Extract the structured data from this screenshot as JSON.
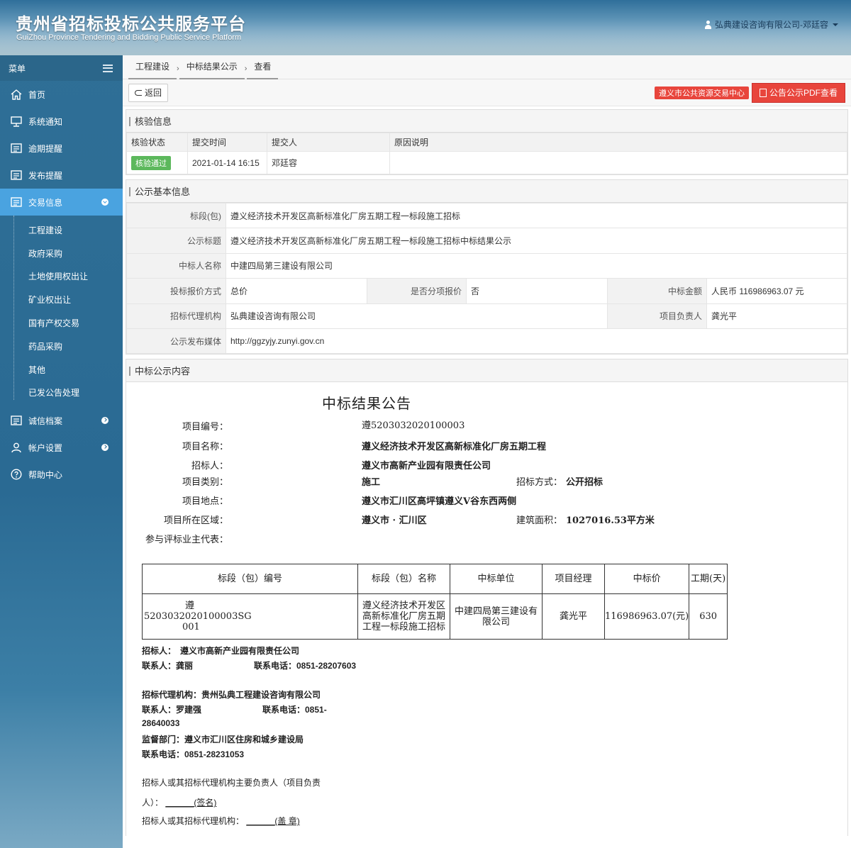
{
  "header": {
    "title": "贵州省招标投标公共服务平台",
    "subtitle": "GuiZhou Province Tendering and Bidding Public Service Platform",
    "user": "弘典建设咨询有限公司-邓廷容"
  },
  "sidebar": {
    "menu_label": "菜单",
    "items": [
      {
        "label": "首页",
        "icon": "home-icon"
      },
      {
        "label": "系统通知",
        "icon": "monitor-icon"
      },
      {
        "label": "逾期提醒",
        "icon": "list-icon"
      },
      {
        "label": "发布提醒",
        "icon": "list-icon"
      },
      {
        "label": "交易信息",
        "icon": "list-icon"
      },
      {
        "label": "诚信档案",
        "icon": "list-icon"
      },
      {
        "label": "帐户设置",
        "icon": "user-icon"
      },
      {
        "label": "帮助中心",
        "icon": "question-icon"
      }
    ],
    "subitems": [
      "工程建设",
      "政府采购",
      "土地使用权出让",
      "矿业权出让",
      "国有产权交易",
      "药品采购",
      "其他",
      "已发公告处理"
    ]
  },
  "breadcrumb": [
    "工程建设",
    "中标结果公示",
    "查看"
  ],
  "toolbar": {
    "back_label": "返回",
    "center_tag": "遵义市公共资源交易中心",
    "pdf_label": "公告公示PDF查看"
  },
  "verify": {
    "title": "核验信息",
    "headers": [
      "核验状态",
      "提交时间",
      "提交人",
      "原因说明"
    ],
    "status": "核验通过",
    "time": "2021-01-14 16:15",
    "submitter": "邓廷容",
    "reason": ""
  },
  "basic": {
    "title": "公示基本信息",
    "section_label": "标段(包)",
    "section_value": "遵义经济技术开发区高新标准化厂房五期工程一标段施工招标",
    "notice_title_label": "公示标题",
    "notice_title_value": "遵义经济技术开发区高新标准化厂房五期工程一标段施工招标中标结果公示",
    "winner_label": "中标人名称",
    "winner_value": "中建四局第三建设有限公司",
    "quote_method_label": "投标报价方式",
    "quote_method_value": "总价",
    "itemized_label": "是否分项报价",
    "itemized_value": "否",
    "amount_label": "中标金额",
    "amount_value": "人民币 116986963.07 元",
    "agency_label": "招标代理机构",
    "agency_value": "弘典建设咨询有限公司",
    "manager_label": "项目负责人",
    "manager_value": "龚光平",
    "media_label": "公示发布媒体",
    "media_value": "http://ggzyjy.zunyi.gov.cn"
  },
  "content": {
    "title": "中标公示内容",
    "doc_title": "中标结果公告",
    "project_no_label": "项目编号：",
    "project_no_value": "遵5203032020100003",
    "project_name_label": "项目名称：",
    "project_name_value": "遵义经济技术开发区高新标准化厂房五期工程",
    "tenderer_label": "招标人：",
    "tenderer_value": "遵义市高新产业园有限责任公司",
    "category_label": "项目类别：",
    "category_value": "施工",
    "method_label": "招标方式：",
    "method_value": "公开招标",
    "location_label": "项目地点：",
    "location_value": "遵义市汇川区高坪镇遵义V谷东西两侧",
    "region_label": "项目所在区域：",
    "region_value": "遵义市 · 汇川区",
    "area_label": "建筑面积：",
    "area_value": "1027016.53平方米",
    "rep_label": "参与评标业主代表：",
    "table_headers": [
      "标段（包）编号",
      "标段（包）名称",
      "中标单位",
      "项目经理",
      "中标价",
      "工期(天)"
    ],
    "table_row": {
      "code_line1": "遵",
      "code_line2": "5203032020100003SG",
      "code_line3": "001",
      "name": "遵义经济技术开发区高新标准化厂房五期工程一标段施工招标",
      "unit": "中建四局第三建设有限公司",
      "manager": "龚光平",
      "price": "116986963.07(元)",
      "duration": "630"
    },
    "tenderer_line": "招标人：　遵义市高新产业园有限责任公司",
    "contact1": "联系人：龚丽",
    "phone1": "联系电话：0851-28207603",
    "agency_line": "招标代理机构：贵州弘典工程建设咨询有限公司",
    "contact2": "联系人：罗建强",
    "phone2a": "联系电话：0851-",
    "phone2b": "28640033",
    "supervisor_line": "监督部门：遵义市汇川区住房和城乡建设局",
    "phone3": "联系电话：0851-28231053",
    "sig1a": "招标人或其招标代理机构主要负责人（项目负责",
    "sig1b": "人）：",
    "sig1c": "______(签名)",
    "sig2a": "招标人或其招标代理机构：",
    "sig2b": "______(盖 章)"
  },
  "colors": {
    "accent": "#4aa3e0",
    "danger": "#e8453c",
    "success": "#5cb85c",
    "sidebar": "#2f6f96"
  }
}
